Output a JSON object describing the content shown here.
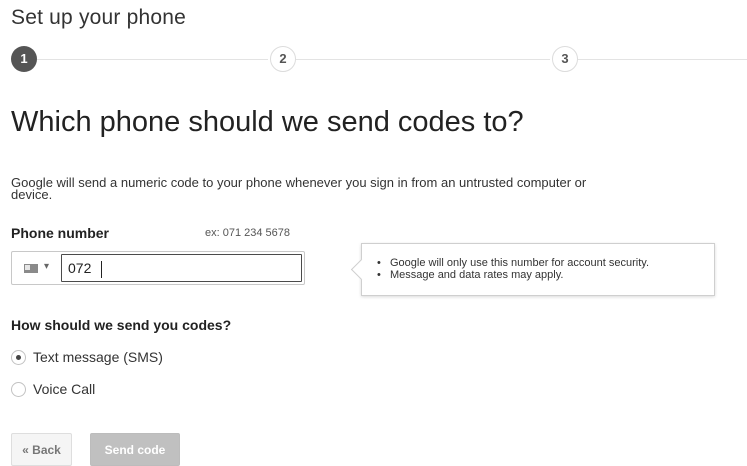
{
  "header": {
    "title": "Set up your phone"
  },
  "stepper": {
    "steps": [
      "1",
      "2",
      "3"
    ],
    "active_step": 1
  },
  "main": {
    "heading": "Which phone should we send codes to?",
    "description": "Google will send a numeric code to your phone whenever you sign in from an untrusted computer or device."
  },
  "phone": {
    "label": "Phone number",
    "example": "ex: 071 234 5678",
    "value": "072",
    "country_icon": "flag-icon"
  },
  "tooltip": {
    "items": [
      "Google will only use this number for account security.",
      "Message and data rates may apply."
    ]
  },
  "method": {
    "heading": "How should we send you codes?",
    "options": [
      {
        "label": "Text message (SMS)",
        "selected": true
      },
      {
        "label": "Voice Call",
        "selected": false
      }
    ]
  },
  "buttons": {
    "back": "« Back",
    "send_code": "Send code"
  },
  "colors": {
    "active_step": "#555555",
    "disabled_button": "#c0c0c0"
  }
}
